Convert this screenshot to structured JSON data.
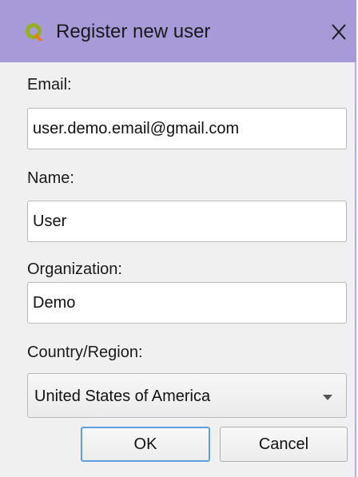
{
  "window": {
    "title": "Register new user",
    "app_icon": "qgis-logo-icon",
    "close_icon": "close-icon",
    "accent_color": "#a899d8"
  },
  "form": {
    "email": {
      "label": "Email:",
      "value": "user.demo.email@gmail.com"
    },
    "name": {
      "label": "Name:",
      "value": "User"
    },
    "organization": {
      "label": "Organization:",
      "value": "Demo"
    },
    "country": {
      "label": "Country/Region:",
      "selected": "United States of America"
    }
  },
  "buttons": {
    "ok_label": "OK",
    "cancel_label": "Cancel"
  }
}
